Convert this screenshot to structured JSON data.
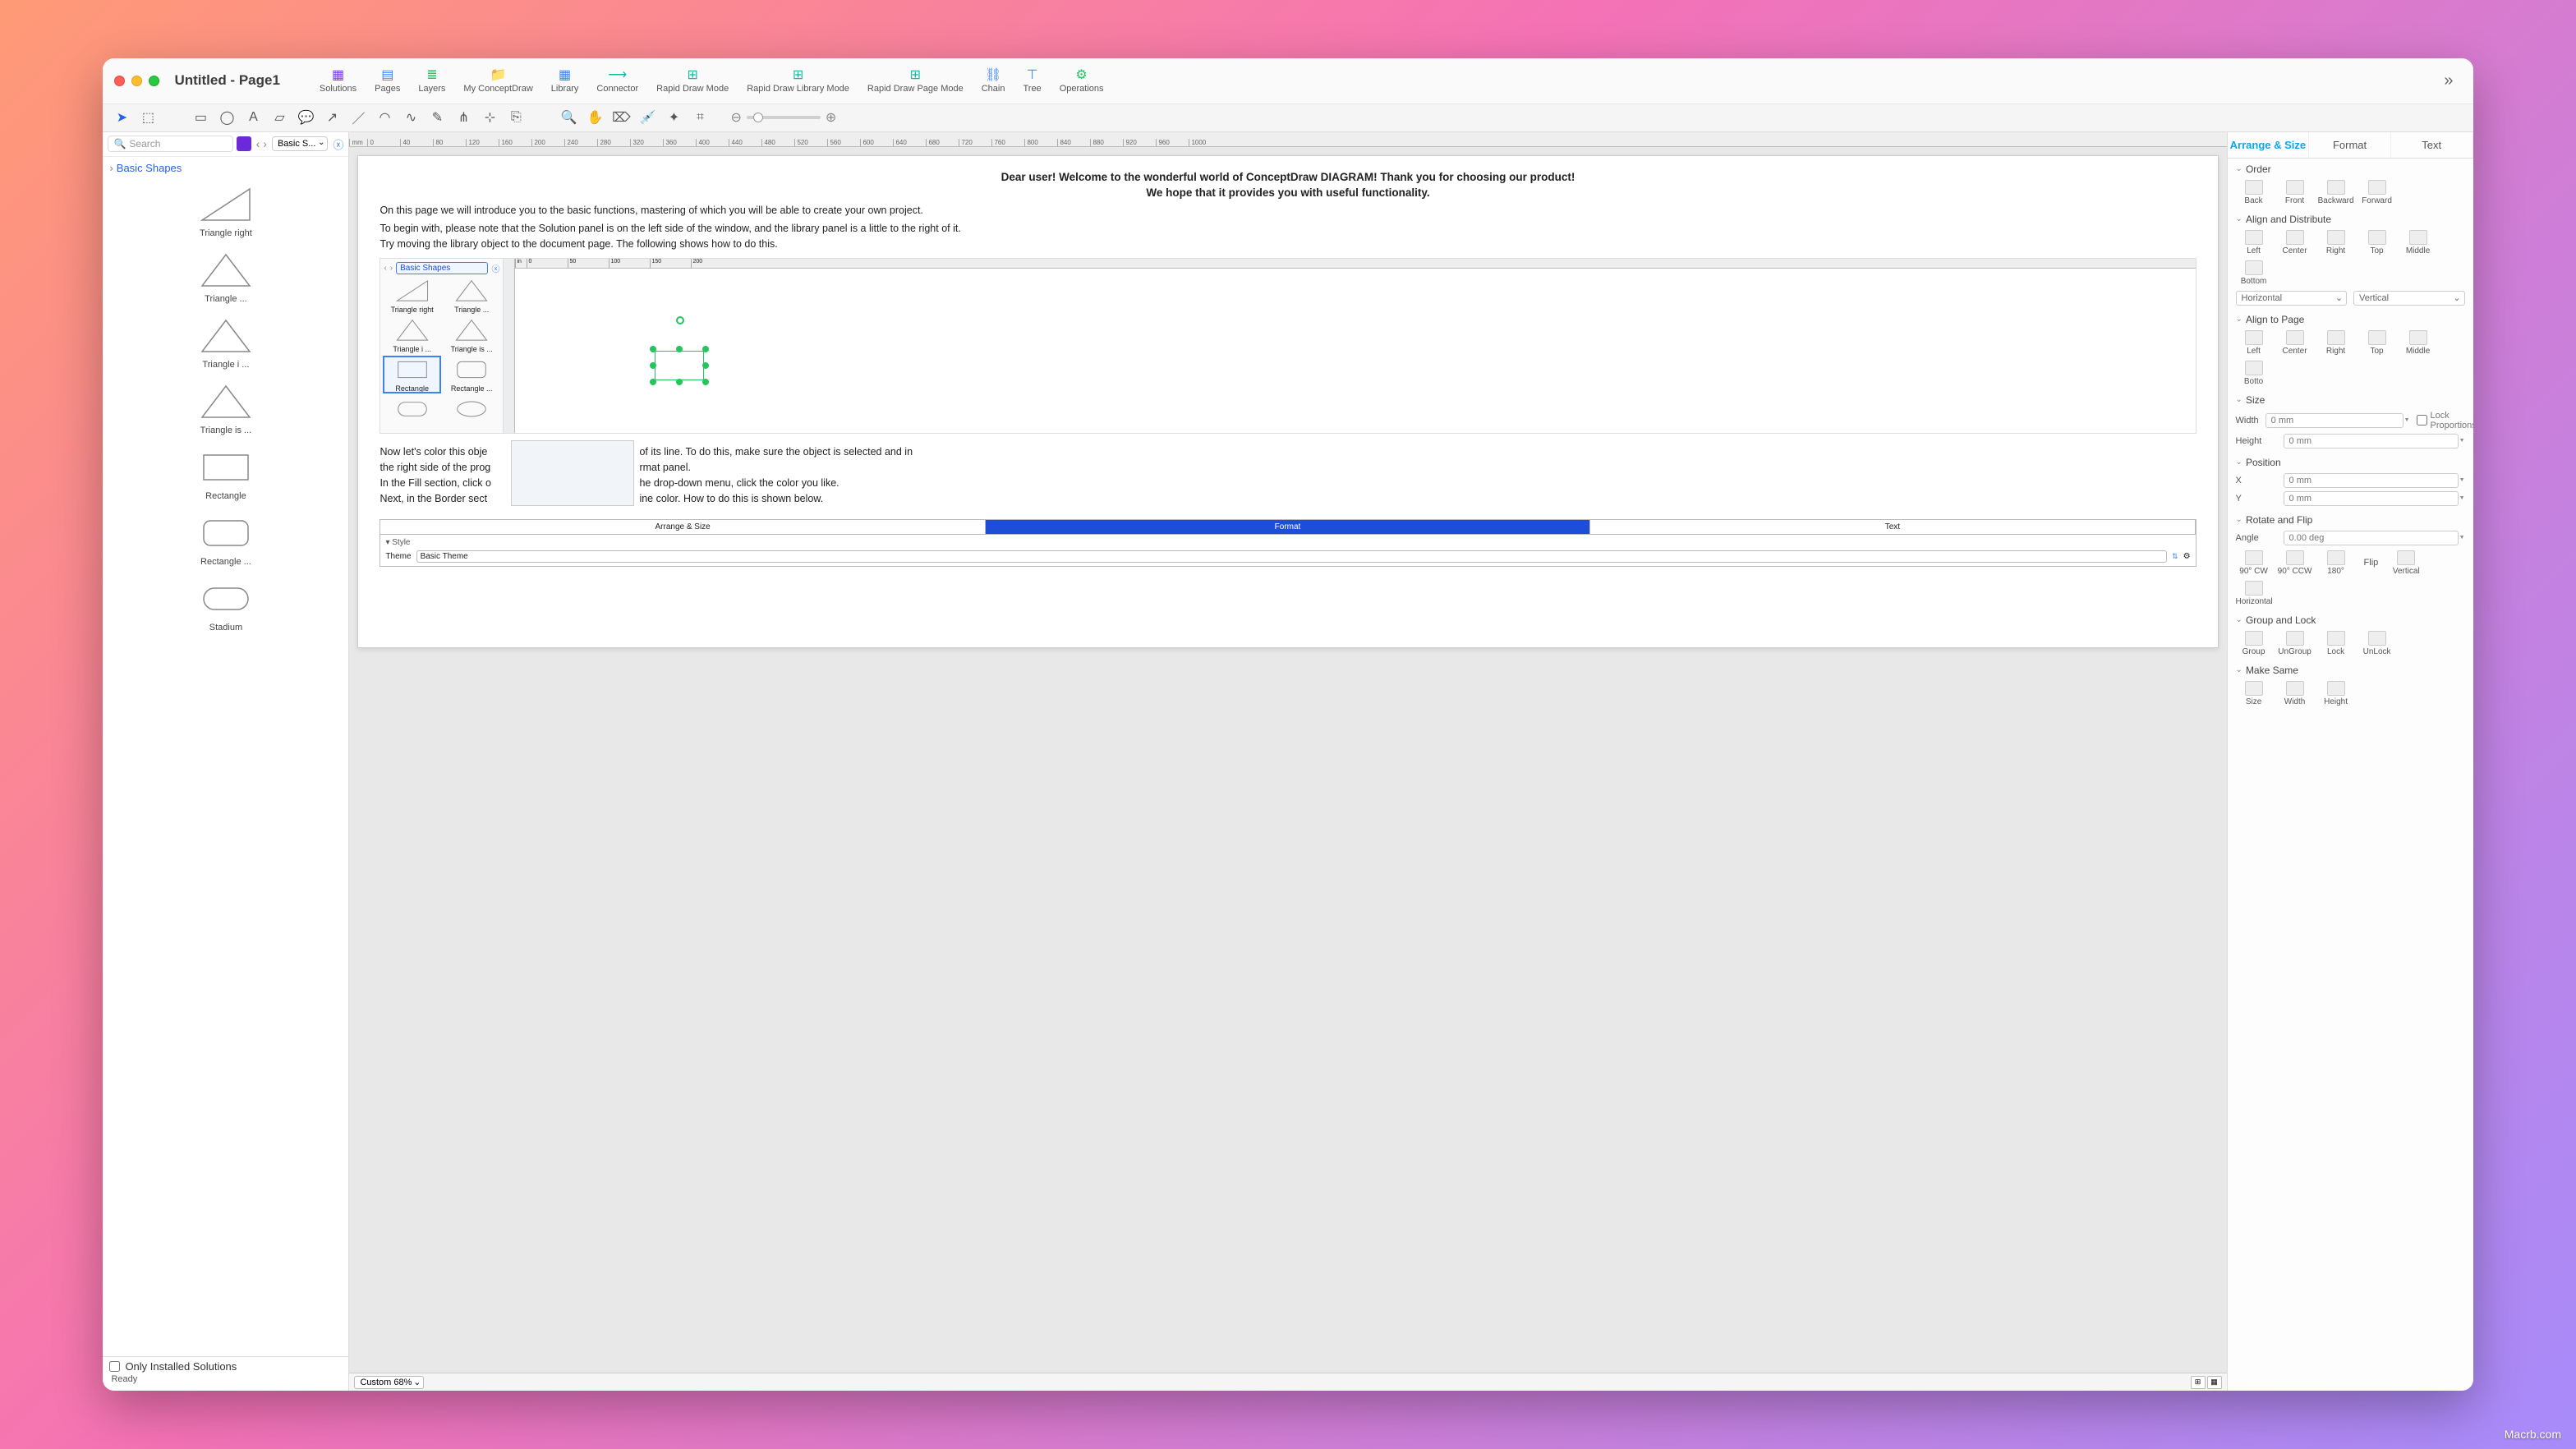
{
  "window": {
    "title": "Untitled - Page1"
  },
  "toolbar": {
    "items": [
      {
        "label": "Solutions"
      },
      {
        "label": "Pages"
      },
      {
        "label": "Layers"
      },
      {
        "label": "My ConceptDraw"
      },
      {
        "label": "Library"
      },
      {
        "label": "Connector"
      },
      {
        "label": "Rapid Draw Mode"
      },
      {
        "label": "Rapid Draw Library Mode"
      },
      {
        "label": "Rapid Draw Page Mode"
      },
      {
        "label": "Chain"
      },
      {
        "label": "Tree"
      },
      {
        "label": "Operations"
      }
    ]
  },
  "sidebar": {
    "search_placeholder": "Search",
    "combo": "Basic S...",
    "tree_root": "Basic Shapes",
    "shapes": [
      {
        "label": "Triangle right",
        "kind": "tri-right"
      },
      {
        "label": "Triangle  ...",
        "kind": "tri"
      },
      {
        "label": "Triangle i ...",
        "kind": "tri"
      },
      {
        "label": "Triangle is ...",
        "kind": "tri"
      },
      {
        "label": "Rectangle",
        "kind": "rect"
      },
      {
        "label": "Rectangle ...",
        "kind": "rrect"
      },
      {
        "label": "Stadium",
        "kind": "stadium"
      }
    ],
    "only_installed": "Only Installed Solutions",
    "status": "Ready"
  },
  "ruler_unit": "mm",
  "doc": {
    "h1": "Dear user! Welcome to the wonderful world of ConceptDraw DIAGRAM! Thank you for choosing our product!",
    "h2": "We hope that it provides you with useful functionality.",
    "p1": "On this page we will introduce you to the basic functions, mastering of which you will be able to create your own project.",
    "p2a": "To begin with, please note that the Solution panel is on the left side of the window, and the library panel is a little to the right of it.",
    "p2b": "Try moving the library object to the document page. The following shows how to do this.",
    "p3a": "Now let's color this obje",
    "p3b": "of its line. To do this, make sure  the object is selected and in",
    "p4a": "the right side of the prog",
    "p4b": "rmat panel.",
    "p5a": "In the Fill section, click o",
    "p5b": "he drop-down menu, click  the color you like.",
    "p6a": "Next, in the Border sect",
    "p6b": "ine color. How to do this is shown below."
  },
  "embedded": {
    "lib_combo": "Basic Shapes",
    "cells": [
      {
        "label": "Triangle right",
        "kind": "tri-right"
      },
      {
        "label": "Triangle  ...",
        "kind": "tri"
      },
      {
        "label": "Triangle i ...",
        "kind": "tri"
      },
      {
        "label": "Triangle is ...",
        "kind": "tri"
      },
      {
        "label": "Rectangle",
        "kind": "rect",
        "sel": true
      },
      {
        "label": "Rectangle ...",
        "kind": "rrect"
      },
      {
        "label": "",
        "kind": "stadium"
      },
      {
        "label": "",
        "kind": "ellipse"
      }
    ],
    "tabs": {
      "a": "Arrange & Size",
      "b": "Format",
      "c": "Text"
    },
    "style_section": "Style",
    "theme_label": "Theme",
    "theme_value": "Basic Theme"
  },
  "zoom": {
    "value": "Custom 68%"
  },
  "inspector": {
    "tabs": {
      "arrange": "Arrange & Size",
      "format": "Format",
      "text": "Text"
    },
    "order": {
      "title": "Order",
      "back": "Back",
      "front": "Front",
      "backward": "Backward",
      "forward": "Forward"
    },
    "align": {
      "title": "Align and Distribute",
      "left": "Left",
      "center": "Center",
      "right": "Right",
      "top": "Top",
      "middle": "Middle",
      "bottom": "Bottom",
      "horiz": "Horizontal",
      "vert": "Vertical"
    },
    "alignpage": {
      "title": "Align to Page",
      "left": "Left",
      "center": "Center",
      "right": "Right",
      "top": "Top",
      "middle": "Middle",
      "bottom": "Botto"
    },
    "size": {
      "title": "Size",
      "width": "Width",
      "height": "Height",
      "ph": "0 mm",
      "lock": "Lock Proportions"
    },
    "position": {
      "title": "Position",
      "x": "X",
      "y": "Y",
      "ph": "0 mm"
    },
    "rotflip": {
      "title": "Rotate and Flip",
      "angle": "Angle",
      "ph": "0.00 deg",
      "cw": "90° CW",
      "ccw": "90° CCW",
      "r180": "180°",
      "flip": "Flip",
      "vert": "Vertical",
      "horiz": "Horizontal"
    },
    "grouplock": {
      "title": "Group and Lock",
      "group": "Group",
      "ungroup": "UnGroup",
      "lock": "Lock",
      "unlock": "UnLock"
    },
    "makesame": {
      "title": "Make Same",
      "size": "Size",
      "width": "Width",
      "height": "Height"
    }
  },
  "watermark": "Macrb.com"
}
